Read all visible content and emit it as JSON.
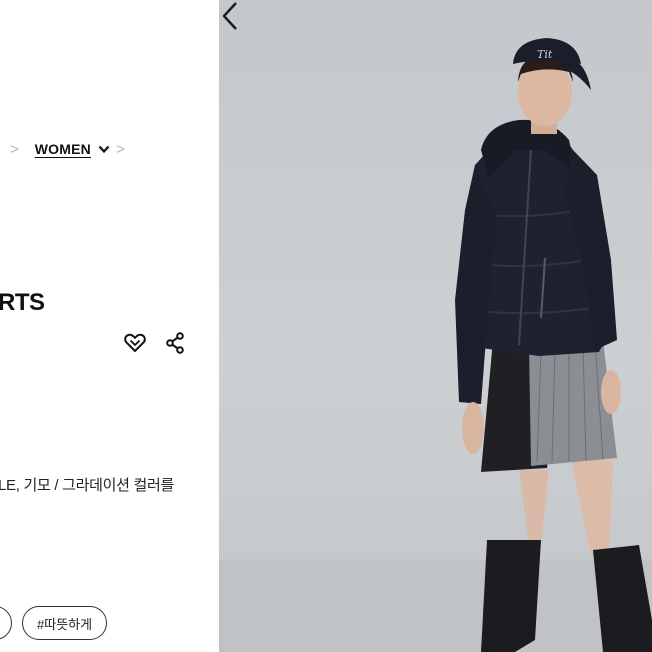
{
  "breadcrumb": {
    "separator": ">",
    "current_label": "WOMEN"
  },
  "product": {
    "title_partial": "RTS",
    "description_partial": "LE, 기모 / 그라데이션 컬러를"
  },
  "tags": [
    {
      "label": "#따뜻하게"
    }
  ],
  "icons": {
    "wishlist": "heart-icon",
    "share": "share-icon",
    "breadcrumb_dropdown": "chevron-down-icon",
    "gallery_prev": "chevron-left-icon"
  },
  "colors": {
    "text": "#111111",
    "separator": "#b5b5b5",
    "photo_background": "#c9cccf",
    "jacket": "#1e2230"
  }
}
